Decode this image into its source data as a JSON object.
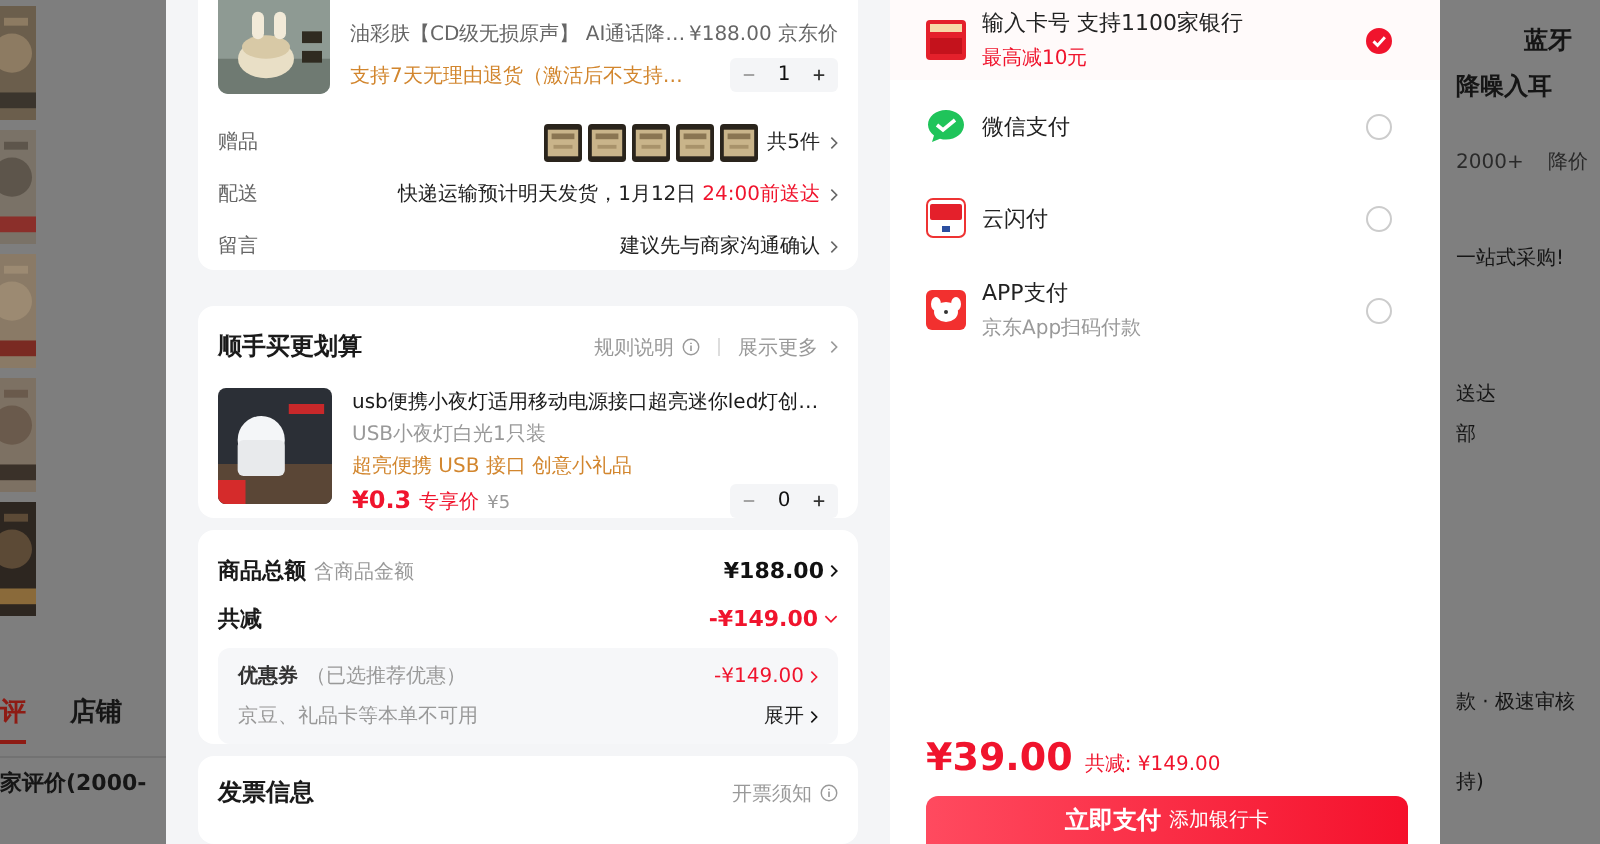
{
  "backdrop": {
    "tabs": [
      {
        "label": "评",
        "selected": true
      },
      {
        "label": "店铺",
        "selected": false
      }
    ],
    "heading": "家评价(2000-",
    "side_texts": [
      "蓝牙",
      "降噪入耳",
      "2000+",
      "降价",
      "一站式采购!",
      "送达",
      "部",
      "款 · 极速审核",
      "持)"
    ]
  },
  "order": {
    "item": {
      "spec": "油彩肤【CD级无损原声】 AI通话降…",
      "price": "¥188.00",
      "price_label": "京东价",
      "service": "支持7天无理由退货（激活后不支持…",
      "quantity": "1"
    },
    "gifts": {
      "label": "赠品",
      "count": "共5件"
    },
    "rows": [
      {
        "label": "配送",
        "value": "快递运输预计明天发货，1月12日",
        "highlight": "24:00前送达"
      },
      {
        "label": "留言",
        "value": "建议先与商家沟通确认"
      }
    ]
  },
  "addon": {
    "title": "顺手买更划算",
    "rules": "规则说明",
    "more": "展示更多",
    "item": {
      "name": "usb便携小夜灯适用移动电源接口超亮迷你led灯创…",
      "spec": "USB小夜灯白光1只装",
      "tags": "超亮便携 USB 接口 创意小礼品",
      "price": "¥0.3",
      "price_label": "专享价",
      "original_price": "¥5",
      "quantity": "0"
    }
  },
  "summary": {
    "total_label": "商品总额",
    "total_note": "含商品金额",
    "total": "¥188.00",
    "discount_label": "共减",
    "discount": "-¥149.00",
    "expanded": true,
    "coupon": {
      "label": "优惠券",
      "note": "（已选推荐优惠）",
      "amount": "-¥149.00",
      "unavailable": "京豆、礼品卡等本单不可用",
      "expand": "展开"
    }
  },
  "invoice": {
    "title": "发票信息",
    "notice": "开票须知"
  },
  "payment": {
    "methods": [
      {
        "kind": "card",
        "name": "输入卡号 支持1100家银行",
        "note": "最高减10元",
        "selected": true
      },
      {
        "kind": "wechat",
        "name": "微信支付",
        "selected": false
      },
      {
        "kind": "unionpay",
        "name": "云闪付",
        "selected": false
      },
      {
        "kind": "app",
        "name": "APP支付",
        "note": "京东App扫码付款",
        "selected": false
      }
    ],
    "total": "¥39.00",
    "saved": "共减: ¥149.00",
    "pay_button": "立即支付",
    "pay_hint": "添加银行卡"
  }
}
